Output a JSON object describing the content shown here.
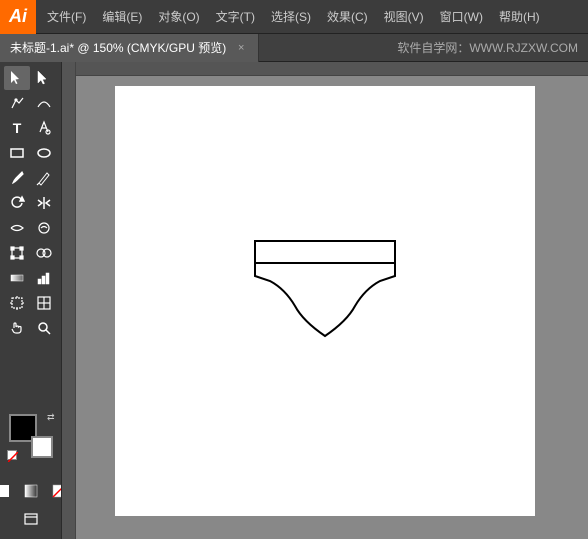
{
  "app": {
    "icon_text": "Ai",
    "icon_bg": "#FF6A00"
  },
  "menu": {
    "items": [
      "文件(F)",
      "编辑(E)",
      "对象(O)",
      "文字(T)",
      "选择(S)",
      "效果(C)",
      "视图(V)",
      "窗口(W)",
      "帮助(H)"
    ]
  },
  "tab": {
    "title": "未标题-1.ai* @ 150% (CMYK/GPU 预览)",
    "close_icon": "×"
  },
  "website": {
    "text": "软件自学网：WWW.RJZXW.COM"
  },
  "tools": {
    "rows": [
      [
        "▶",
        "◈"
      ],
      [
        "✏",
        "✒"
      ],
      [
        "✏",
        "✒"
      ],
      [
        "T",
        "⊘"
      ],
      [
        "□",
        "◎"
      ],
      [
        "✏",
        "◈"
      ],
      [
        "↺",
        "⊞"
      ],
      [
        "✦",
        "⊙"
      ],
      [
        "⊕",
        "⊘"
      ],
      [
        "⊞",
        "⊟"
      ],
      [
        "▣",
        "⊠"
      ],
      [
        "✋",
        "🔍"
      ]
    ]
  },
  "colors": {
    "fill": "black",
    "stroke": "white"
  }
}
